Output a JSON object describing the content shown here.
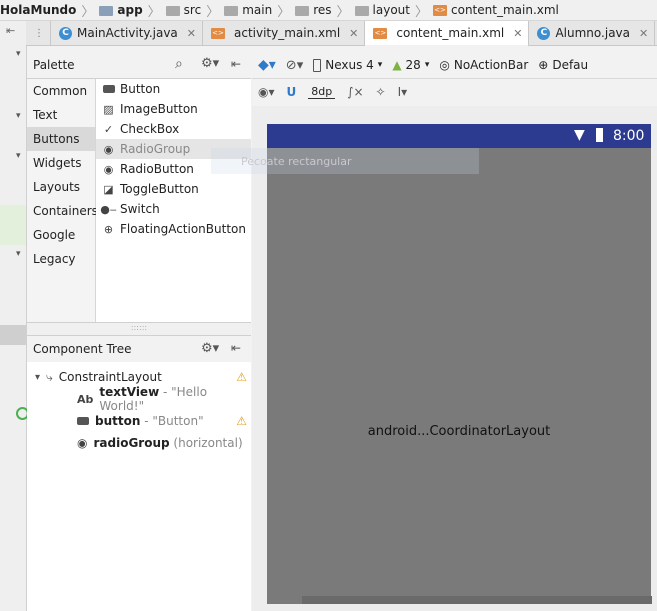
{
  "breadcrumbs": [
    "HolaMundo",
    "app",
    "src",
    "main",
    "res",
    "layout",
    "content_main.xml"
  ],
  "tabs": [
    {
      "label": "MainActivity.java",
      "icon": "c-class-icon"
    },
    {
      "label": "activity_main.xml",
      "icon": "xml-file-icon"
    },
    {
      "label": "content_main.xml",
      "icon": "xml-file-icon",
      "active": true
    },
    {
      "label": "Alumno.java",
      "icon": "c-class-icon"
    }
  ],
  "palette": {
    "title": "Palette",
    "categories": [
      "Common",
      "Text",
      "Buttons",
      "Widgets",
      "Layouts",
      "Containers",
      "Google",
      "Legacy"
    ],
    "selected_category": "Buttons",
    "items": [
      "Button",
      "ImageButton",
      "CheckBox",
      "RadioGroup",
      "RadioButton",
      "ToggleButton",
      "Switch",
      "FloatingActionButton"
    ],
    "selected_item": "RadioGroup"
  },
  "drag_hint": "Pecoate rectangular",
  "component_tree": {
    "title": "Component Tree",
    "root": "ConstraintLayout",
    "children": [
      {
        "name": "textView",
        "detail": " - \"Hello World!\"",
        "prefix": "Ab",
        "warning": false
      },
      {
        "name": "button",
        "detail": " - \"Button\"",
        "prefix": "",
        "warning": true
      },
      {
        "name": "radioGroup",
        "detail": " (horizontal)",
        "prefix": "",
        "warning": false
      }
    ]
  },
  "toolbar": {
    "device": "Nexus 4",
    "api": "28",
    "theme": "NoActionBar",
    "locale": "Defau",
    "margin": "8dp"
  },
  "device": {
    "time": "8:00",
    "center_text": "android...CoordinatorLayout"
  },
  "colors": {
    "statusbar": "#2c3b8f",
    "device_bg": "#7a7a7a",
    "warning": "#e0a020",
    "accent_icon": "#3d8fd1"
  }
}
